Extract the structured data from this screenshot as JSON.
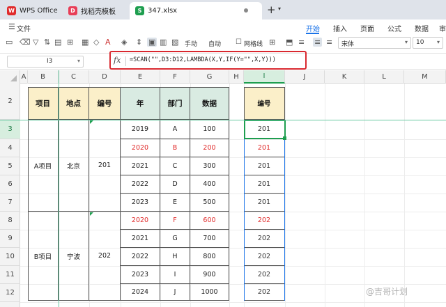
{
  "tabs": [
    {
      "label": "WPS Office",
      "icon": "wps-icon"
    },
    {
      "label": "找稻壳模板",
      "icon": "template-icon"
    },
    {
      "label": "347.xlsx",
      "icon": "spreadsheet-icon"
    }
  ],
  "menu": {
    "file": "文件",
    "ribbon_tabs": [
      "开始",
      "插入",
      "页面",
      "公式",
      "数据",
      "审"
    ],
    "active_tab": "开始"
  },
  "toolbar": {
    "manual_label": "手动",
    "auto_label": "自动",
    "gridlines_label": "网格线",
    "font_name": "宋体",
    "font_size": "10"
  },
  "formula_bar": {
    "cell_ref": "I3",
    "fx": "fx",
    "formula": "=SCAN(\"\",D3:D12,LAMBDA(X,Y,IF(Y=\"\",X,Y)))"
  },
  "columns": [
    "A",
    "B",
    "C",
    "D",
    "E",
    "F",
    "G",
    "H",
    "I",
    "J",
    "K",
    "L",
    "M"
  ],
  "rows": [
    "2",
    "3",
    "4",
    "5",
    "6",
    "7",
    "8",
    "9",
    "10",
    "11",
    "12"
  ],
  "table": {
    "headers": [
      "项目",
      "地点",
      "编号",
      "年",
      "部门",
      "数据"
    ],
    "group_a": {
      "project": "A项目",
      "place": "北京",
      "code": "201"
    },
    "group_b": {
      "project": "B项目",
      "place": "宁波",
      "code": "202"
    },
    "records": [
      {
        "year": "2019",
        "dept": "A",
        "value": "100",
        "highlight": false
      },
      {
        "year": "2020",
        "dept": "B",
        "value": "200",
        "highlight": true
      },
      {
        "year": "2021",
        "dept": "C",
        "value": "300",
        "highlight": false
      },
      {
        "year": "2022",
        "dept": "D",
        "value": "400",
        "highlight": false
      },
      {
        "year": "2023",
        "dept": "E",
        "value": "500",
        "highlight": false
      },
      {
        "year": "2020",
        "dept": "F",
        "value": "600",
        "highlight": true
      },
      {
        "year": "2021",
        "dept": "G",
        "value": "700",
        "highlight": false
      },
      {
        "year": "2022",
        "dept": "H",
        "value": "800",
        "highlight": false
      },
      {
        "year": "2023",
        "dept": "I",
        "value": "900",
        "highlight": false
      },
      {
        "year": "2024",
        "dept": "J",
        "value": "1000",
        "highlight": false
      }
    ]
  },
  "result": {
    "header": "编号",
    "values": [
      {
        "v": "201",
        "highlight": false
      },
      {
        "v": "201",
        "highlight": true
      },
      {
        "v": "201",
        "highlight": false
      },
      {
        "v": "201",
        "highlight": false
      },
      {
        "v": "201",
        "highlight": false
      },
      {
        "v": "202",
        "highlight": true
      },
      {
        "v": "202",
        "highlight": false
      },
      {
        "v": "202",
        "highlight": false
      },
      {
        "v": "202",
        "highlight": false
      },
      {
        "v": "202",
        "highlight": false
      }
    ]
  },
  "watermark": "@吉哥计划",
  "colors": {
    "accent": "#1a73e8",
    "highlight_red": "#e02b2b",
    "header_yellow": "#fbefc9",
    "header_green": "#d9ebe2",
    "selection": "#1e9e4f"
  }
}
